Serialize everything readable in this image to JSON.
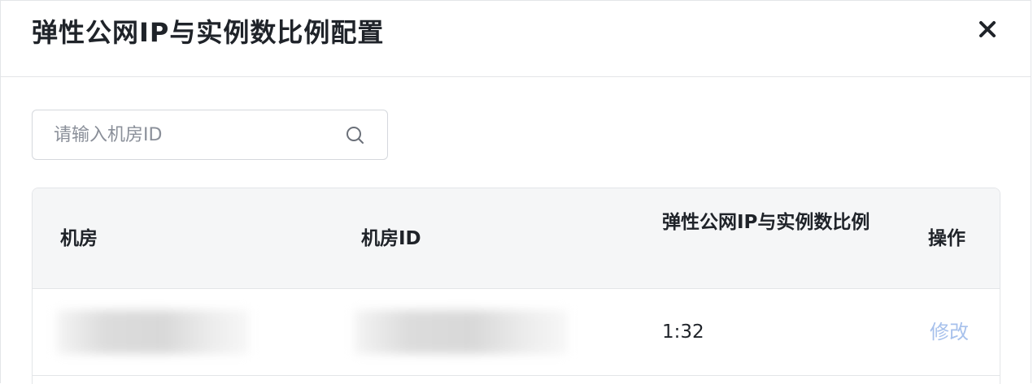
{
  "dialog": {
    "title": "弹性公网IP与实例数比例配置",
    "close_label": "×"
  },
  "search": {
    "placeholder": "请输入机房ID",
    "value": ""
  },
  "table": {
    "columns": [
      "机房",
      "机房ID",
      "弹性公网IP与实例数比例",
      "操作"
    ],
    "rows": [
      {
        "room": "",
        "room_id": "",
        "ratio": "1:32",
        "action": "修改"
      }
    ]
  },
  "colors": {
    "text": "#1f2329",
    "header_bg": "#f5f6f7",
    "border": "#e3e5e8",
    "link_disabled": "#a7c1ec"
  },
  "icons": [
    "close-icon",
    "search-icon"
  ]
}
